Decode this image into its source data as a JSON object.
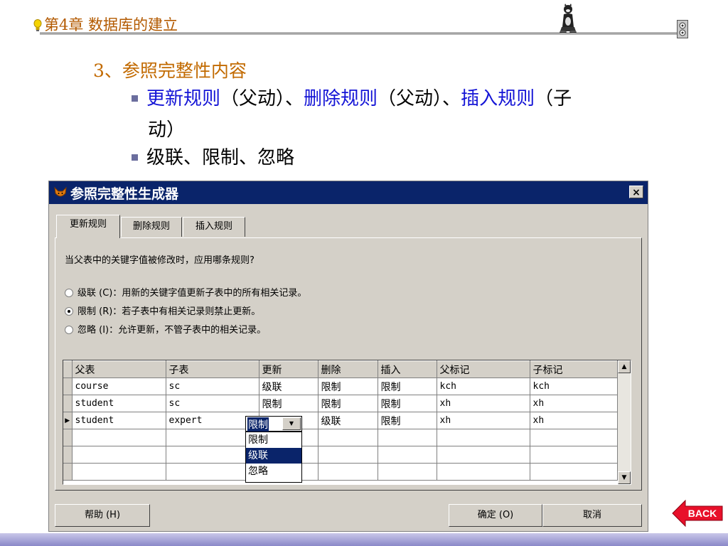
{
  "slide": {
    "header_title": "第4章  数据库的建立",
    "section_title": "3、参照完整性内容",
    "bullet1": {
      "kw1": "更新规则",
      "t1": "（父动）、",
      "kw2": "删除规则",
      "t2": "（父动）、",
      "kw3": "插入规则",
      "t3": "（子",
      "cont": "动）"
    },
    "bullet2": "级联、限制、忽略",
    "back_label": "BACK"
  },
  "dialog": {
    "title": "参照完整性生成器",
    "close_glyph": "×",
    "tabs": [
      "更新规则",
      "删除规则",
      "插入规则"
    ],
    "active_tab": 0,
    "question": "当父表中的关键字值被修改时，应用哪条规则?",
    "options": [
      {
        "label": "级联 (C)：用新的关键字值更新子表中的所有相关记录。",
        "selected": false
      },
      {
        "label": "限制 (R)：若子表中有相关记录则禁止更新。",
        "selected": true
      },
      {
        "label": "忽略 (I)：允许更新，不管子表中的相关记录。",
        "selected": false
      }
    ],
    "grid": {
      "columns": [
        "父表",
        "子表",
        "更新",
        "删除",
        "插入",
        "父标记",
        "子标记"
      ],
      "rows": [
        [
          "course",
          "sc",
          "级联",
          "限制",
          "限制",
          "kch",
          "kch"
        ],
        [
          "student",
          "sc",
          "限制",
          "限制",
          "限制",
          "xh",
          "xh"
        ],
        [
          "student",
          "expert",
          "限制",
          "级联",
          "限制",
          "xh",
          "xh"
        ]
      ],
      "current_row_marker": "▶",
      "dropdown": {
        "value": "限制",
        "options": [
          "限制",
          "级联",
          "忽略"
        ],
        "highlighted": 1
      },
      "scroll_up": "▲",
      "scroll_down": "▼"
    },
    "buttons": {
      "help": "帮助 (H)",
      "ok": "确定 (O)",
      "cancel": "取消"
    }
  }
}
